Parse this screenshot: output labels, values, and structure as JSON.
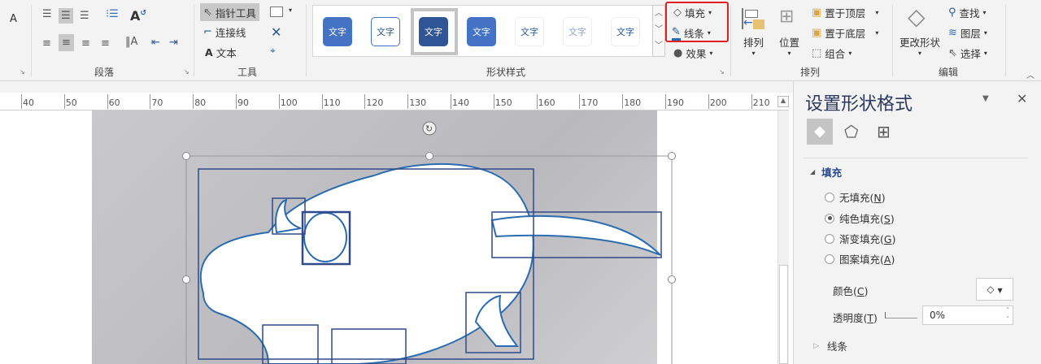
{
  "ribbon": {
    "paragraph": {
      "label": "段落"
    },
    "tools": {
      "label": "工具",
      "pointer": "指针工具",
      "connector": "连接线",
      "text": "文本",
      "text_icon": "A"
    },
    "shape_styles": {
      "label": "形状样式",
      "items": [
        "文字",
        "文字",
        "文字",
        "文字",
        "文字",
        "文字",
        "文字"
      ]
    },
    "fill": "填充",
    "line": "线条",
    "effects": "效果",
    "arrange": {
      "label": "排列",
      "arrange_btn": "排列",
      "position": "位置",
      "bring_front": "置于顶层",
      "send_back": "置于底层",
      "group": "组合"
    },
    "editing": {
      "label": "编辑",
      "change_shape": "更改形状",
      "find": "查找",
      "layers": "图层",
      "select": "选择"
    }
  },
  "ruler": {
    "ticks": [
      "40",
      "50",
      "60",
      "70",
      "80",
      "90",
      "100",
      "110",
      "120",
      "130",
      "140",
      "150",
      "160",
      "170",
      "180",
      "190",
      "200",
      "210"
    ]
  },
  "pane": {
    "title": "设置形状格式",
    "fill_section": "填充",
    "options": [
      {
        "label": "无填充",
        "key": "N",
        "selected": false
      },
      {
        "label": "纯色填充",
        "key": "S",
        "selected": true
      },
      {
        "label": "渐变填充",
        "key": "G",
        "selected": false
      },
      {
        "label": "图案填充",
        "key": "A",
        "selected": false
      }
    ],
    "color_label": "颜色",
    "color_key": "C",
    "transparency_label": "透明度",
    "transparency_key": "T",
    "transparency_value": "0%",
    "line_section": "线条"
  },
  "colors": {
    "accent": "#4472c4",
    "highlight": "#e02020",
    "shape_outline": "#2f4a8a"
  }
}
